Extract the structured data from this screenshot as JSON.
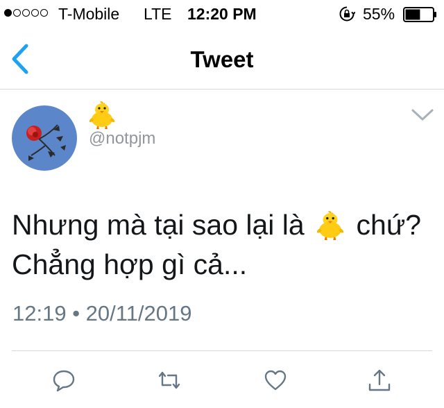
{
  "status_bar": {
    "signal_dots_filled": 1,
    "signal_dots_total": 5,
    "carrier": "T-Mobile",
    "network": "LTE",
    "time": "12:20 PM",
    "battery_percent": "55%",
    "battery_level": 0.55
  },
  "nav": {
    "title": "Tweet",
    "back_icon": "chevron-left-icon"
  },
  "tweet": {
    "display_name_icon": "baby-chick-emoji",
    "handle": "@notpjm",
    "text_part1": "Nhưng mà tại sao lại là",
    "text_emoji": "baby-chick-emoji",
    "text_part2": "chứ?",
    "text_line2": "Chẳng hợp gì cả...",
    "timestamp": "12:19 • 20/11/2019"
  },
  "actions": [
    "reply-icon",
    "retweet-icon",
    "like-icon",
    "share-icon"
  ],
  "colors": {
    "accent": "#1da1f2",
    "action_icon": "#657786",
    "muted_text": "#8f96a0"
  }
}
